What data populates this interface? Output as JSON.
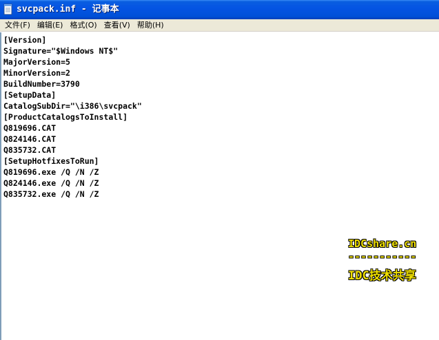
{
  "window": {
    "title": "svcpack.inf - 记事本",
    "icon": "notepad-icon"
  },
  "menu": [
    {
      "label": "文件(F)"
    },
    {
      "label": "编辑(E)"
    },
    {
      "label": "格式(O)"
    },
    {
      "label": "查看(V)"
    },
    {
      "label": "帮助(H)"
    }
  ],
  "document": {
    "lines": [
      "[Version]",
      "Signature=\"$Windows NT$\"",
      "MajorVersion=5",
      "MinorVersion=2",
      "BuildNumber=3790",
      "[SetupData]",
      "CatalogSubDir=\"\\i386\\svcpack\"",
      "[ProductCatalogsToInstall]",
      "Q819696.CAT",
      "Q824146.CAT",
      "Q835732.CAT",
      "[SetupHotfixesToRun]",
      "Q819696.exe /Q /N /Z",
      "Q824146.exe /Q /N /Z",
      "Q835732.exe /Q /N /Z"
    ]
  },
  "watermark": {
    "site": "IDCshare.cn",
    "divider": "-----------",
    "tagline": "IDC技术共享"
  }
}
